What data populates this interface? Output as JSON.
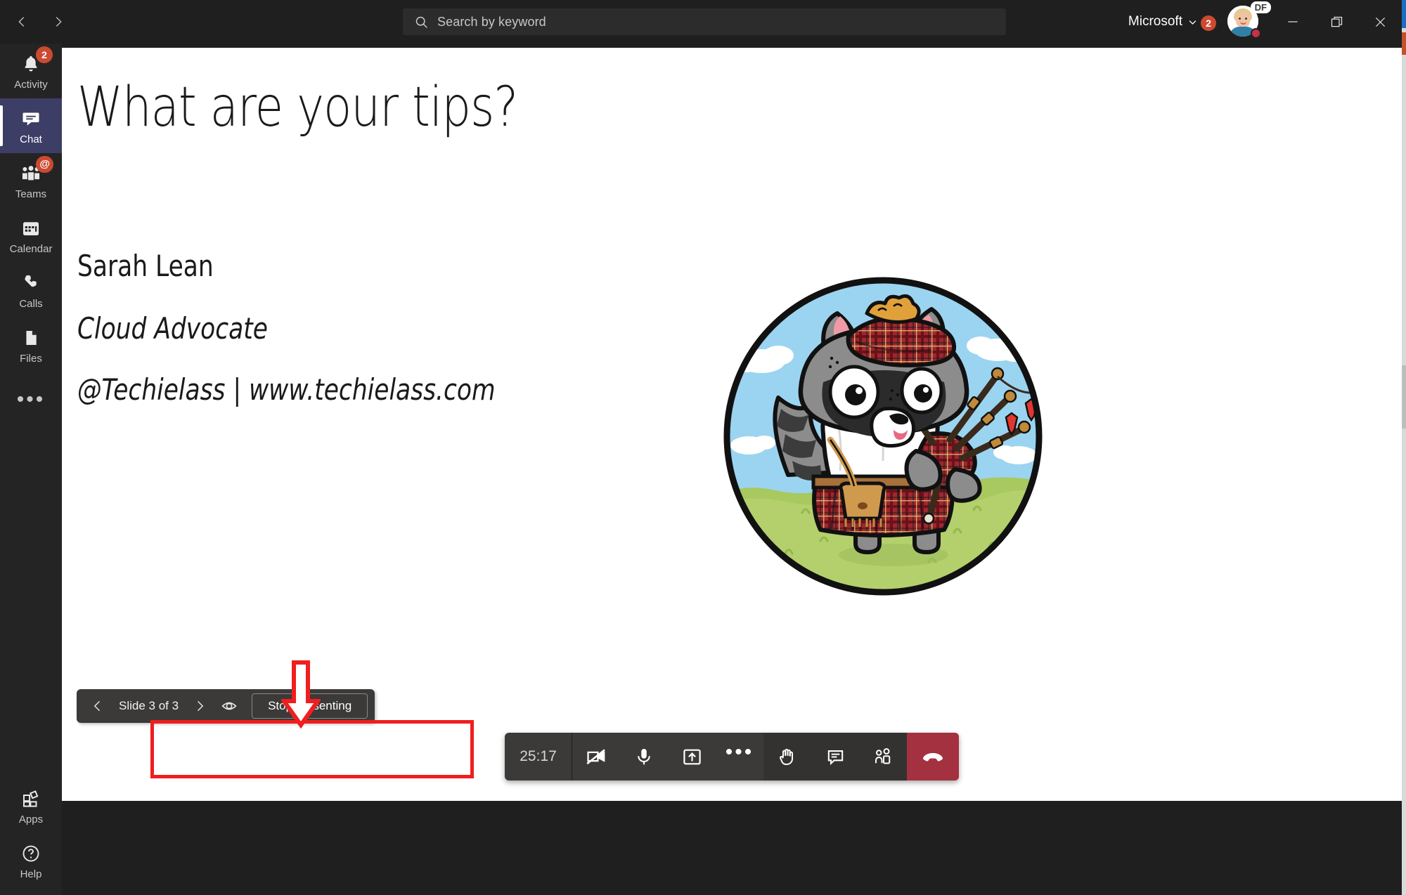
{
  "window": {
    "org_name": "Microsoft",
    "org_badge_count": "2",
    "avatar_initials_badge": "DF",
    "minimize_label": "Minimize",
    "restore_label": "Restore",
    "close_label": "Close",
    "back_label": "Back",
    "forward_label": "Forward"
  },
  "search": {
    "placeholder": "Search by keyword",
    "value": "",
    "icon": "search-icon"
  },
  "rail": {
    "items": [
      {
        "label": "Activity",
        "icon": "bell-icon",
        "badge": "2",
        "active": false
      },
      {
        "label": "Chat",
        "icon": "chat-icon",
        "badge": "",
        "active": true
      },
      {
        "label": "Teams",
        "icon": "people-icon",
        "badge": "@",
        "active": false
      },
      {
        "label": "Calendar",
        "icon": "calendar-icon",
        "badge": "",
        "active": false
      },
      {
        "label": "Calls",
        "icon": "phone-icon",
        "badge": "",
        "active": false
      },
      {
        "label": "Files",
        "icon": "file-icon",
        "badge": "",
        "active": false
      }
    ],
    "more_label": "More options",
    "bottom_items": [
      {
        "label": "Apps",
        "icon": "apps-icon"
      },
      {
        "label": "Help",
        "icon": "help-icon"
      }
    ]
  },
  "slide": {
    "title": "What are your tips?",
    "line1": "Sarah Lean",
    "line2": "Cloud Advocate",
    "line3": "@Techielass | www.techielass.com",
    "image_alt": "raccoon-bagpiper-illustration"
  },
  "slide_controls": {
    "previous_label": "Previous slide",
    "slide_counter": "Slide 3 of 3",
    "next_label": "Next slide",
    "private_view_label": "Private view",
    "stop_label": "Stop presenting"
  },
  "annotation": {
    "highlight_color": "#f01e1e",
    "arrow_target": "slide-controls-bar"
  },
  "meeting_toolbar": {
    "timer": "25:17",
    "buttons": [
      {
        "label": "Turn camera on",
        "icon": "camera-off-icon"
      },
      {
        "label": "Mute",
        "icon": "microphone-icon"
      },
      {
        "label": "Share content",
        "icon": "share-screen-icon"
      },
      {
        "label": "More actions",
        "icon": "ellipsis-icon"
      },
      {
        "label": "Raise hand",
        "icon": "raise-hand-icon"
      },
      {
        "label": "Show conversation",
        "icon": "chat-bubble-icon"
      },
      {
        "label": "Show participants",
        "icon": "participants-icon"
      }
    ],
    "hangup_label": "Leave",
    "hangup_color": "#a4313f"
  }
}
